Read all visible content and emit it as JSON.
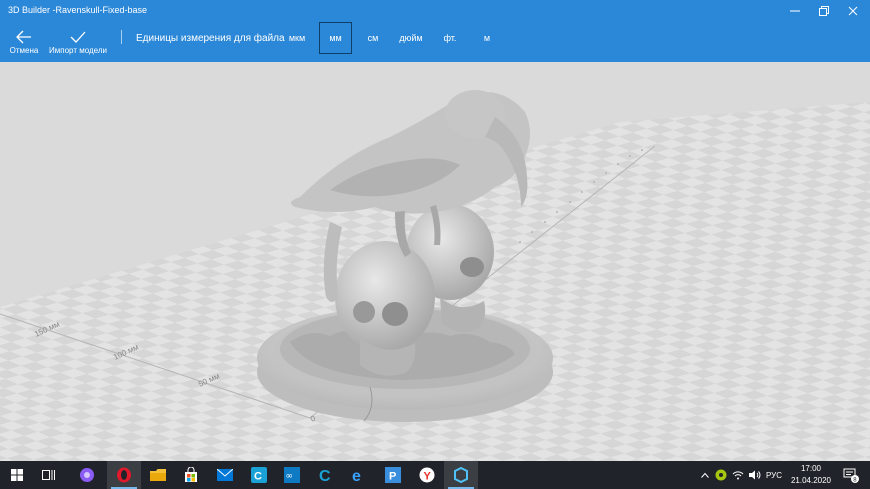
{
  "window": {
    "title": "3D Builder -Ravenskull-Fixed-base"
  },
  "toolbar": {
    "cancel_label": "Отмена",
    "import_label": "Импорт модели",
    "units_label": "Единицы измерения для файла",
    "units": [
      "мкм",
      "мм",
      "см",
      "дюйм",
      "фт.",
      "м"
    ],
    "selected_unit": "мм"
  },
  "viewport": {
    "axis_labels": [
      "0",
      "50 мм",
      "100 мм",
      "150 мм"
    ],
    "background_color": "#dadada",
    "model_color": "#c8c8c8"
  },
  "taskbar": {
    "apps": [
      "start-icon",
      "task-view-icon",
      "alice-icon",
      "opera-icon",
      "file-explorer-icon",
      "store-icon",
      "mail-icon",
      "ccleaner-icon",
      "infinity-icon",
      "cortana-c-icon",
      "edge-icon",
      "p-app-icon",
      "yandex-browser-icon",
      "3d-builder-icon"
    ],
    "language": "РУС",
    "time": "17:00",
    "date": "21.04.2020",
    "notification_count": "8"
  },
  "colors": {
    "accent": "#2b88d8",
    "taskbar": "#20242a"
  }
}
